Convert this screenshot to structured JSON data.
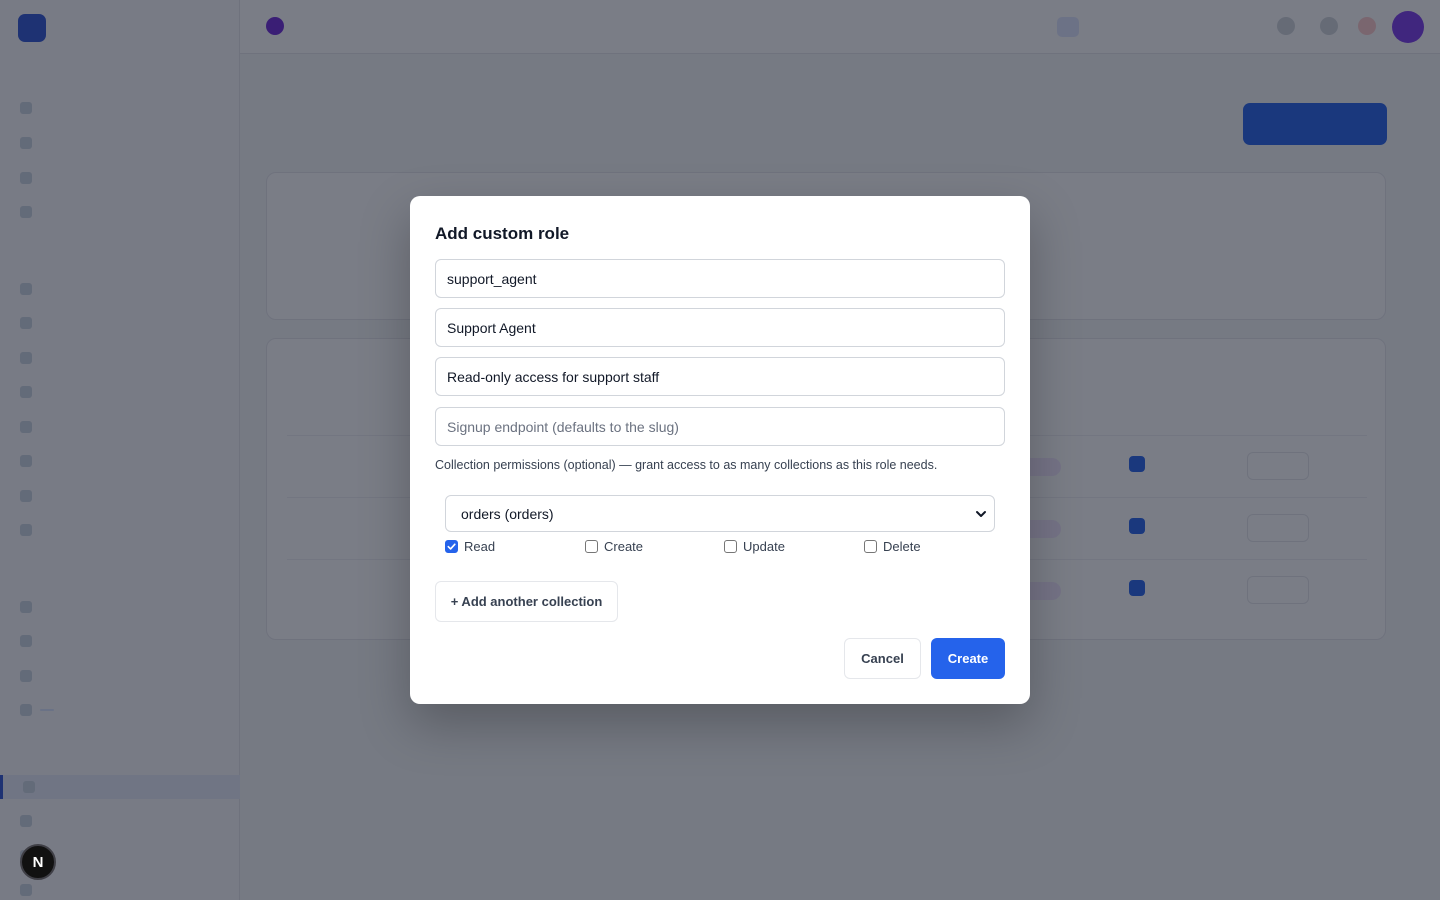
{
  "modal": {
    "title": "Add custom role",
    "slug_value": "support_agent",
    "name_value": "Support Agent",
    "description_value": "Read-only access for support staff",
    "endpoint_placeholder": "Signup endpoint (defaults to the slug)",
    "permissions_hint": "Collection permissions (optional) — grant access to as many collections as this role needs.",
    "collection_selected": "orders (orders)",
    "permissions": [
      {
        "label": "Read",
        "checked": true
      },
      {
        "label": "Create",
        "checked": false
      },
      {
        "label": "Update",
        "checked": false
      },
      {
        "label": "Delete",
        "checked": false
      }
    ],
    "add_collection_label": "+ Add another collection",
    "cancel_label": "Cancel",
    "create_label": "Create"
  },
  "dev_badge": {
    "letter": "N"
  },
  "colors": {
    "accent": "#2563eb",
    "overlay": "rgba(17,24,39,0.56)",
    "avatar": "#7c3aed"
  },
  "icons": {
    "select": "chevron-down-icon",
    "checkbox": "check-icon"
  }
}
